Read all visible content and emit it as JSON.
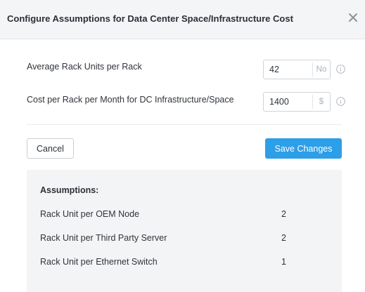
{
  "header": {
    "title": "Configure Assumptions for Data Center Space/Infrastructure Cost",
    "close_icon": "close-icon"
  },
  "fields": [
    {
      "label": "Average Rack Units per Rack",
      "value": "42",
      "unit": "No"
    },
    {
      "label": "Cost per Rack per Month for DC Infrastructure/Space",
      "value": "1400",
      "unit": "$"
    }
  ],
  "actions": {
    "cancel_label": "Cancel",
    "save_label": "Save Changes"
  },
  "assumptions": {
    "title": "Assumptions:",
    "rows": [
      {
        "label": "Rack Unit per OEM Node",
        "value": "2"
      },
      {
        "label": "Rack Unit per Third Party Server",
        "value": "2"
      },
      {
        "label": "Rack Unit per Ethernet Switch",
        "value": "1"
      }
    ]
  },
  "colors": {
    "primary": "#2d9ee8",
    "header_bg": "#f4f5f7",
    "panel_bg": "#f3f4f6"
  }
}
